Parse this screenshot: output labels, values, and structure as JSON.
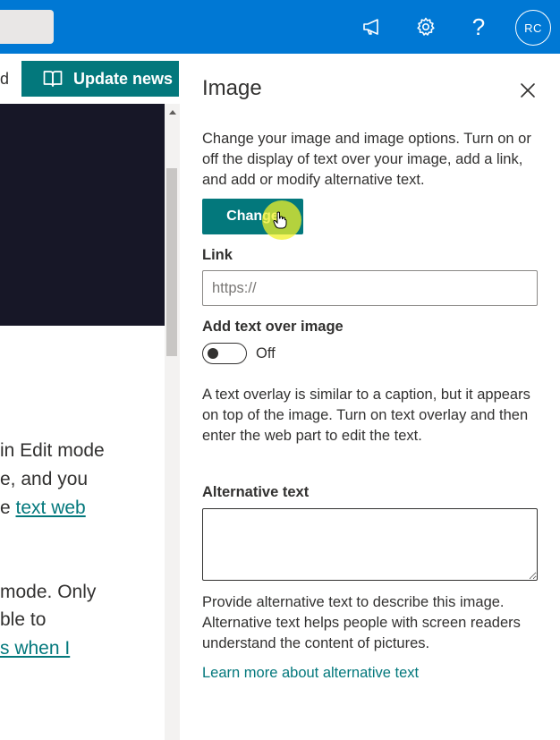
{
  "suite_bar": {
    "avatar_initials": "RC",
    "help_glyph": "?",
    "icons": [
      "megaphone-icon",
      "gear-icon",
      "help-icon"
    ],
    "background_color": "#0078d4"
  },
  "page": {
    "command_fragment": "d",
    "update_news_label": "Update news",
    "body_lines": [
      {
        "text": "in Edit mode",
        "link": ""
      },
      {
        "text": "e, and you",
        "link": ""
      },
      {
        "text": "e ",
        "link": "text web"
      },
      {
        "text": "mode. Only",
        "link": ""
      },
      {
        "text": "ble to",
        "link": ""
      },
      {
        "text": "",
        "link": "s when I"
      }
    ]
  },
  "pane": {
    "title": "Image",
    "description": "Change your image and image options. Turn on or off the display of text over your image, add a link, and add or modify alternative text.",
    "change_button_label": "Change",
    "link_label": "Link",
    "link_placeholder": "https://",
    "link_value": "",
    "text_over_image_label": "Add text over image",
    "toggle_state": "Off",
    "overlay_help": "A text overlay is similar to a caption, but it appears on top of the image. Turn on text overlay and then enter the web part to edit the text.",
    "alt_text_label": "Alternative text",
    "alt_text_value": "",
    "alt_text_help": "Provide alternative text to describe this image. Alternative text helps people with screen readers understand the content of pictures.",
    "learn_more_link": "Learn more about alternative text",
    "accent_color": "#03787c"
  }
}
